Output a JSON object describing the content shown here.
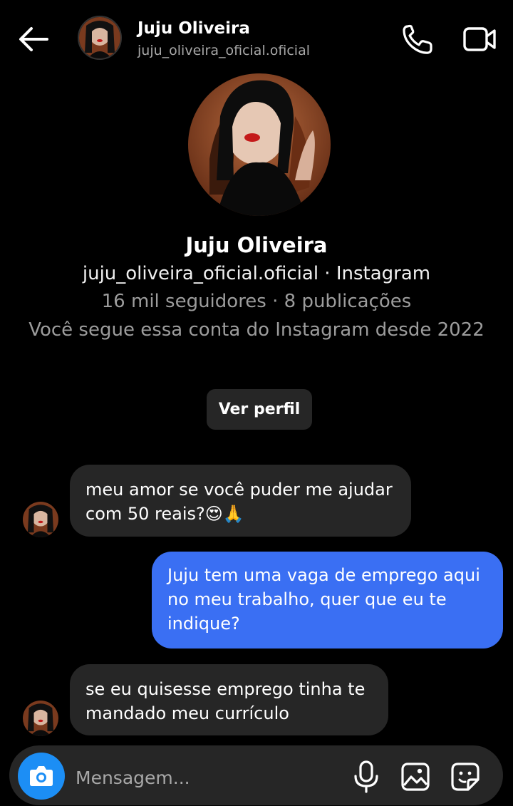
{
  "header": {
    "name": "Juju Oliveira",
    "username": "juju_oliveira_oficial.oficial",
    "icons": [
      "back-arrow-icon",
      "phone-icon",
      "video-camera-icon"
    ]
  },
  "profile": {
    "name": "Juju Oliveira",
    "handle_line": "juju_oliveira_oficial.oficial · Instagram",
    "stats_line": "16 mil seguidores · 8 publicações",
    "since_line": "Você segue essa conta do Instagram desde 2022",
    "view_profile_label": "Ver perfil"
  },
  "messages": [
    {
      "from": "them",
      "lines": [
        "meu amor se você puder me ajudar",
        "com 50 reais?😍🙏"
      ]
    },
    {
      "from": "me",
      "lines": [
        "Juju tem uma vaga de emprego aqui",
        "no meu trabalho, quer que eu te",
        "indique?"
      ]
    },
    {
      "from": "them",
      "lines": [
        "se eu quisesse emprego tinha te",
        "mandado meu currículo"
      ]
    }
  ],
  "composer": {
    "placeholder": "Mensagem...",
    "icons": [
      "camera-icon",
      "microphone-icon",
      "gallery-icon",
      "sticker-icon"
    ]
  },
  "colors": {
    "background": "#000000",
    "bubble_incoming": "#262626",
    "bubble_outgoing": "#3a6ff3",
    "camera_button": "#1c8ef5",
    "secondary_text": "#a8a8a8"
  }
}
